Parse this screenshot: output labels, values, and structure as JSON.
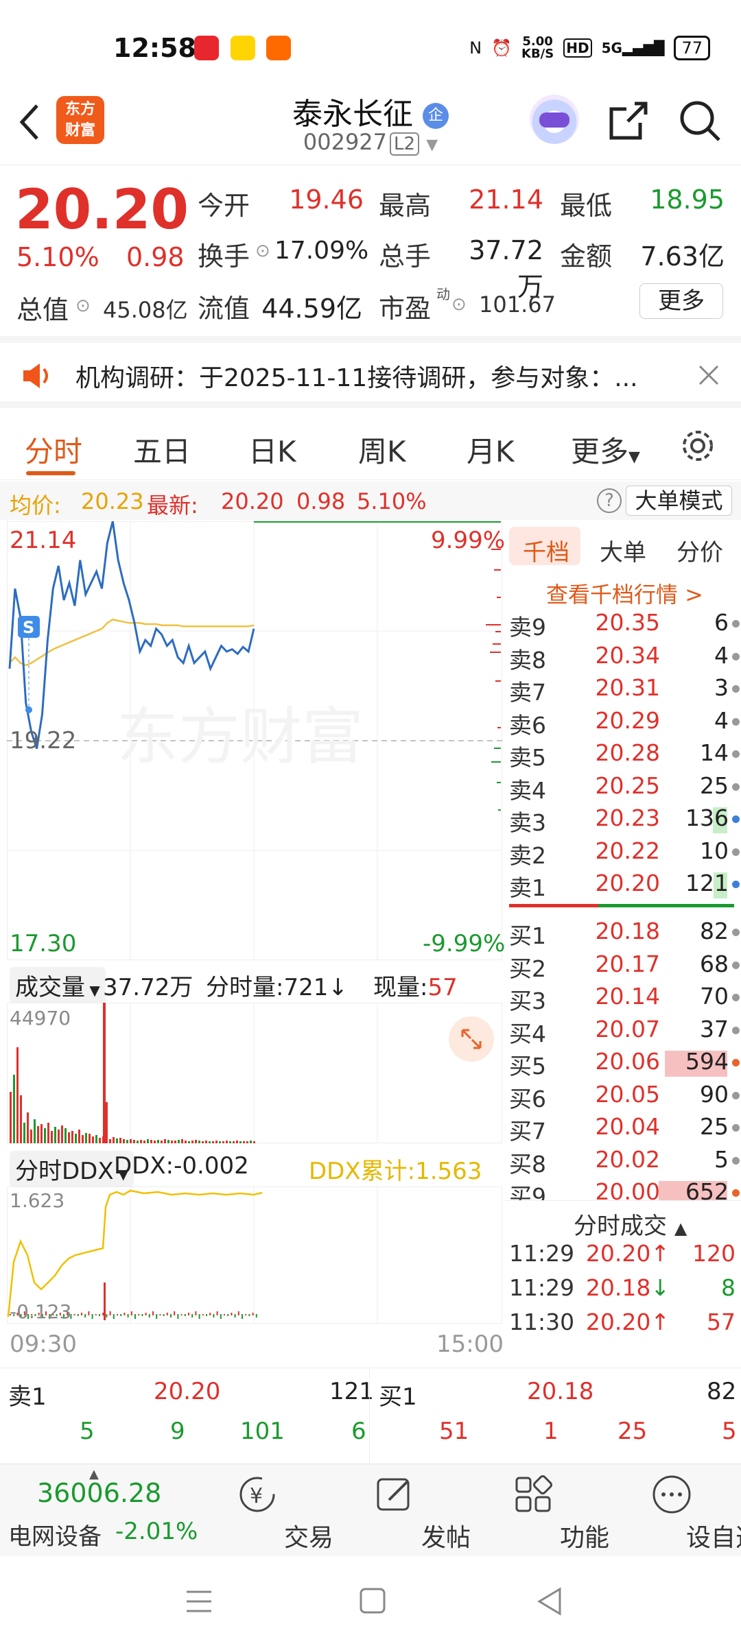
{
  "status": {
    "time": "12:58",
    "net_speed": "5.00",
    "net_unit": "KB/S",
    "hd": "HD",
    "signal": "5G",
    "battery": "77"
  },
  "header": {
    "logo": "东方\n财富",
    "name": "泰永长征",
    "name_badge": "企",
    "code": "002927",
    "level": "L2"
  },
  "quote": {
    "price": "20.20",
    "pct": "5.10%",
    "chg": "0.98",
    "open_label": "今开",
    "open": "19.46",
    "high_label": "最高",
    "high": "21.14",
    "low_label": "最低",
    "low": "18.95",
    "turnover_label": "换手",
    "turnover": "17.09%",
    "volume_label": "总手",
    "volume": "37.72万",
    "amount_label": "金额",
    "amount": "7.63亿",
    "mktcap_label": "总值",
    "mktcap": "45.08亿",
    "float_label": "流值",
    "float": "44.59亿",
    "pe_label": "市盈",
    "pe_sup": "动",
    "pe": "101.67",
    "more": "更多"
  },
  "news": {
    "text": "机构调研：于2025-11-11接待调研，参与对象：..."
  },
  "tabs": [
    "分时",
    "五日",
    "日K",
    "周K",
    "月K",
    "更多"
  ],
  "infobar": {
    "avg_label": "均价:",
    "avg": "20.23",
    "last_label": "最新:",
    "last": "20.20",
    "chg": "0.98",
    "pct": "5.10%",
    "mode_btn": "大单模式"
  },
  "chart_data": {
    "type": "line",
    "y_top": "21.14",
    "y_mid": "19.22",
    "y_bottom": "17.30",
    "pct_top": "9.99%",
    "pct_bottom": "-9.99%",
    "watermark": "东方财富",
    "x_start": "09:30",
    "x_end": "15:00",
    "ylim": [
      17.3,
      21.14
    ],
    "price": [
      19.85,
      20.55,
      20.3,
      19.55,
      19.3,
      19.15,
      19.45,
      20.1,
      20.55,
      20.75,
      20.45,
      20.6,
      20.4,
      20.8,
      20.5,
      20.6,
      20.7,
      20.55,
      20.95,
      21.14,
      20.8,
      20.6,
      20.45,
      20.25,
      20.0,
      20.1,
      20.05,
      20.2,
      20.15,
      20.05,
      20.1,
      19.95,
      19.9,
      20.05,
      19.9,
      19.95,
      20.0,
      19.85,
      19.95,
      20.05,
      20.0,
      20.02,
      19.98,
      20.04,
      20.0,
      20.2
    ],
    "avg": [
      19.9,
      19.95,
      19.9,
      19.88,
      19.9,
      19.93,
      19.96,
      19.99,
      20.02,
      20.04,
      20.06,
      20.08,
      20.1,
      20.12,
      20.14,
      20.16,
      20.18,
      20.2,
      20.25,
      20.28,
      20.27,
      20.26,
      20.25,
      20.25,
      20.25,
      20.24,
      20.24,
      20.24,
      20.23,
      20.23,
      20.23,
      20.23,
      20.22,
      20.22,
      20.22,
      20.22,
      20.22,
      20.22,
      20.22,
      20.22,
      20.22,
      20.22,
      20.22,
      20.22,
      20.22,
      20.23
    ]
  },
  "volume": {
    "label": "成交量",
    "total": "37.72万",
    "tick_label": "分时量:",
    "tick": "721",
    "tick_arrow": "↓",
    "now_label": "现量:",
    "now": "57",
    "max": "44970"
  },
  "ddx": {
    "label": "分时DDX",
    "value_label": "DDX:",
    "value": "-0.002",
    "cum_label": "DDX累计:",
    "cum": "1.563",
    "top": "1.623",
    "bottom": "-0.123"
  },
  "orderbook": {
    "tabs": [
      "千档",
      "大单",
      "分价"
    ],
    "link": "查看千档行情 >",
    "asks": [
      {
        "label": "卖9",
        "price": "20.35",
        "vol": "6"
      },
      {
        "label": "卖8",
        "price": "20.34",
        "vol": "4"
      },
      {
        "label": "卖7",
        "price": "20.31",
        "vol": "3"
      },
      {
        "label": "卖6",
        "price": "20.29",
        "vol": "4"
      },
      {
        "label": "卖5",
        "price": "20.28",
        "vol": "14"
      },
      {
        "label": "卖4",
        "price": "20.25",
        "vol": "25"
      },
      {
        "label": "卖3",
        "price": "20.23",
        "vol": "136"
      },
      {
        "label": "卖2",
        "price": "20.22",
        "vol": "10"
      },
      {
        "label": "卖1",
        "price": "20.20",
        "vol": "121"
      }
    ],
    "bids": [
      {
        "label": "买1",
        "price": "20.18",
        "vol": "82"
      },
      {
        "label": "买2",
        "price": "20.17",
        "vol": "68"
      },
      {
        "label": "买3",
        "price": "20.14",
        "vol": "70"
      },
      {
        "label": "买4",
        "price": "20.07",
        "vol": "37"
      },
      {
        "label": "买5",
        "price": "20.06",
        "vol": "594"
      },
      {
        "label": "买6",
        "price": "20.05",
        "vol": "90"
      },
      {
        "label": "买7",
        "price": "20.04",
        "vol": "25"
      },
      {
        "label": "买8",
        "price": "20.02",
        "vol": "5"
      },
      {
        "label": "买9",
        "price": "20.00",
        "vol": "652"
      }
    ],
    "trades_title": "分时成交",
    "trades": [
      {
        "time": "11:29",
        "price": "20.20",
        "arrow": "↑",
        "vol": "120"
      },
      {
        "time": "11:29",
        "price": "20.18",
        "arrow": "↓",
        "vol": "8"
      },
      {
        "time": "11:30",
        "price": "20.20",
        "arrow": "↑",
        "vol": "57"
      }
    ]
  },
  "bidask": {
    "sell_label": "卖1",
    "sell_price": "20.20",
    "sell_vol": "121",
    "buy_label": "买1",
    "buy_price": "20.18",
    "buy_vol": "82",
    "sell_queue": [
      "5",
      "9",
      "101",
      "6"
    ],
    "buy_queue": [
      "51",
      "1",
      "25",
      "5"
    ]
  },
  "nav": {
    "index_value": "36006.28",
    "index_name": "电网设备",
    "index_pct": "-2.01%",
    "items": [
      "交易",
      "发帖",
      "功能",
      "设自选"
    ]
  }
}
